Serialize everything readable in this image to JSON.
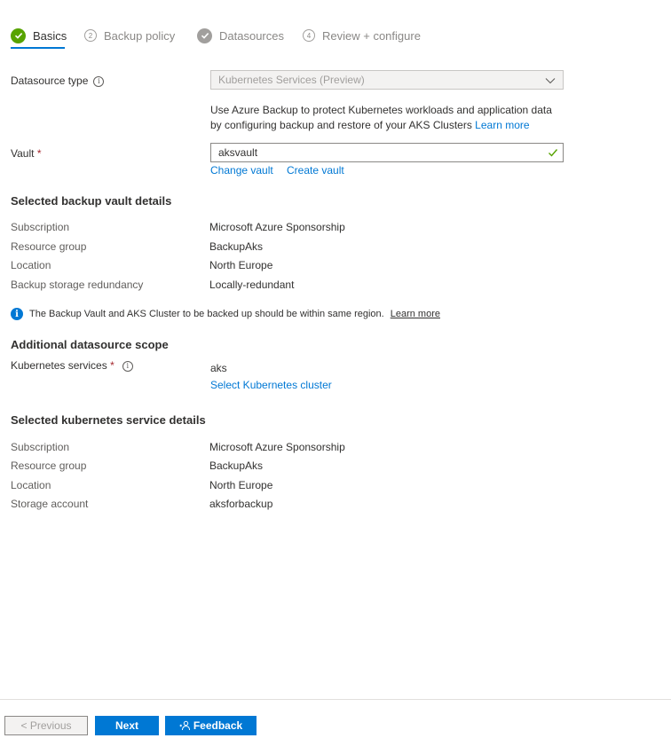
{
  "tabs": [
    {
      "label": "Basics",
      "state": "complete",
      "active": true
    },
    {
      "label": "Backup policy",
      "number": "2",
      "state": "pending"
    },
    {
      "label": "Datasources",
      "state": "complete-gray"
    },
    {
      "label": "Review + configure",
      "number": "4",
      "state": "pending"
    }
  ],
  "datasource": {
    "label": "Datasource type",
    "value": "Kubernetes Services (Preview)",
    "description": "Use Azure Backup to protect Kubernetes workloads and application data by configuring backup and restore of your AKS Clusters",
    "learn_more": "Learn more"
  },
  "vault": {
    "label": "Vault",
    "required_mark": "*",
    "value": "aksvault",
    "change_link": "Change vault",
    "create_link": "Create vault"
  },
  "vault_details": {
    "heading": "Selected backup vault details",
    "rows": [
      {
        "label": "Subscription",
        "value": "Microsoft Azure Sponsorship"
      },
      {
        "label": "Resource group",
        "value": "BackupAks"
      },
      {
        "label": "Location",
        "value": "North Europe"
      },
      {
        "label": "Backup storage redundancy",
        "value": "Locally-redundant"
      }
    ]
  },
  "region_note": {
    "text": "The Backup Vault and AKS Cluster to be backed up should be within same region.",
    "link": "Learn more"
  },
  "scope": {
    "heading": "Additional datasource scope",
    "label": "Kubernetes services",
    "required_mark": "*",
    "value": "aks",
    "select_link": "Select Kubernetes cluster"
  },
  "k8s_details": {
    "heading": "Selected kubernetes service details",
    "rows": [
      {
        "label": "Subscription",
        "value": "Microsoft Azure Sponsorship"
      },
      {
        "label": "Resource group",
        "value": "BackupAks"
      },
      {
        "label": "Location",
        "value": "North Europe"
      },
      {
        "label": "Storage account",
        "value": "aksforbackup"
      }
    ]
  },
  "footer": {
    "previous": "< Previous",
    "next": "Next",
    "feedback": "Feedback"
  },
  "colors": {
    "accent": "#0078d4",
    "success": "#57a300",
    "required": "#a4262c"
  }
}
